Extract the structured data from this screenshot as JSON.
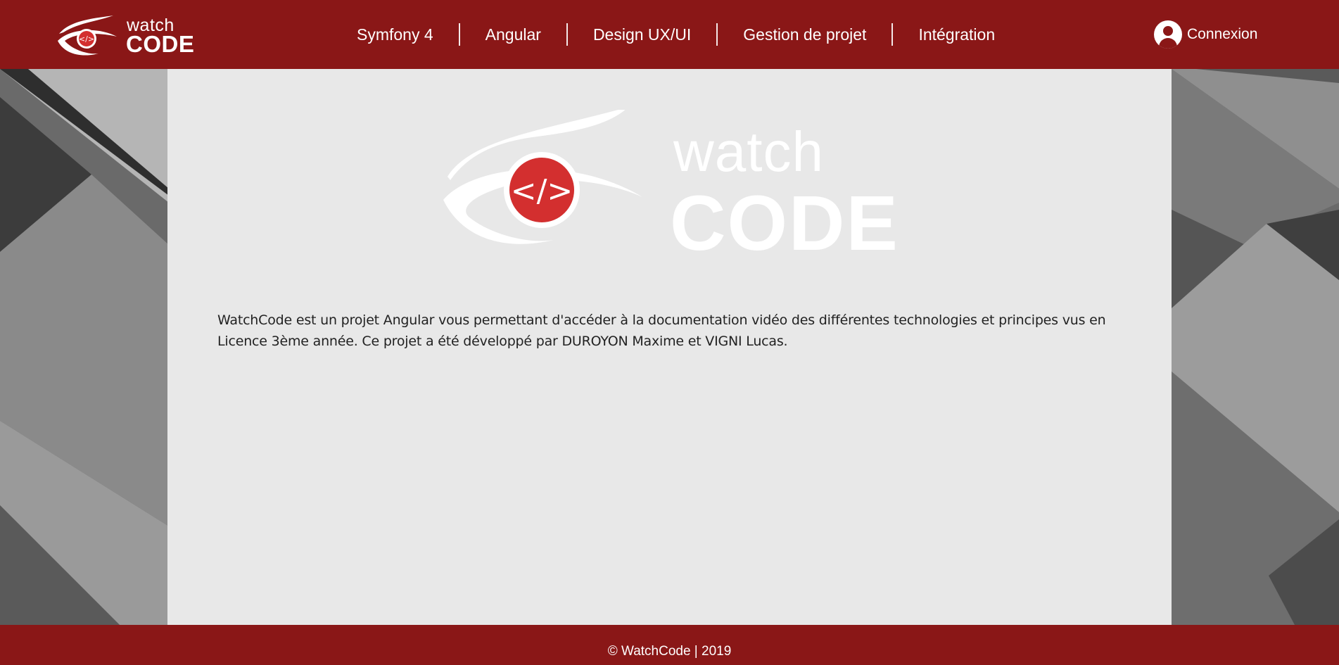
{
  "brand": {
    "line1": "watch",
    "line2": "CODE"
  },
  "nav": {
    "items": [
      {
        "label": "Symfony 4"
      },
      {
        "label": "Angular"
      },
      {
        "label": "Design UX/UI"
      },
      {
        "label": "Gestion de projet"
      },
      {
        "label": "Intégration"
      }
    ],
    "login_label": "Connexion",
    "login_icon": "user-circle-icon"
  },
  "hero": {
    "line1": "watch",
    "line2": "CODE",
    "icon": "eye-code-icon"
  },
  "main": {
    "description": "WatchCode est un projet Angular vous permettant d'accéder à la documentation vidéo des différentes technologies et principes vus en Licence 3ème année. Ce projet a été développé par DUROYON Maxime et VIGNI Lucas."
  },
  "footer": {
    "text": "© WatchCode | 2019"
  },
  "colors": {
    "brand_red": "#8a1717",
    "eye_red": "#d32f2f",
    "panel_bg": "#e8e8e8"
  }
}
